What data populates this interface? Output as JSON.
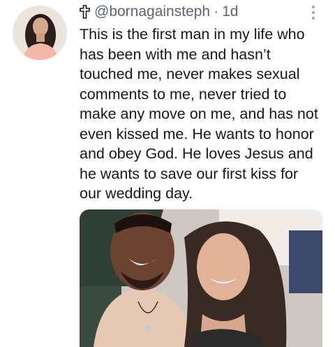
{
  "tweet": {
    "handle": "@bornagainsteph",
    "separator": "·",
    "time": "1d",
    "text": "This is the first man in my life who\nhas been with me and hasn’t\ntouched me, never makes sexual\ncomments to me, never tried to\nmake any move on me,  and has not\neven kissed me. He wants to honor\nand obey God. He loves Jesus and\nhe wants to save our first kiss for\nour wedding day."
  },
  "icons": {
    "badge": "cross-icon",
    "menu": "more-vertical-icon",
    "avatar": "profile-avatar"
  },
  "colors": {
    "text": "#15181b",
    "secondary": "#5b6670"
  }
}
